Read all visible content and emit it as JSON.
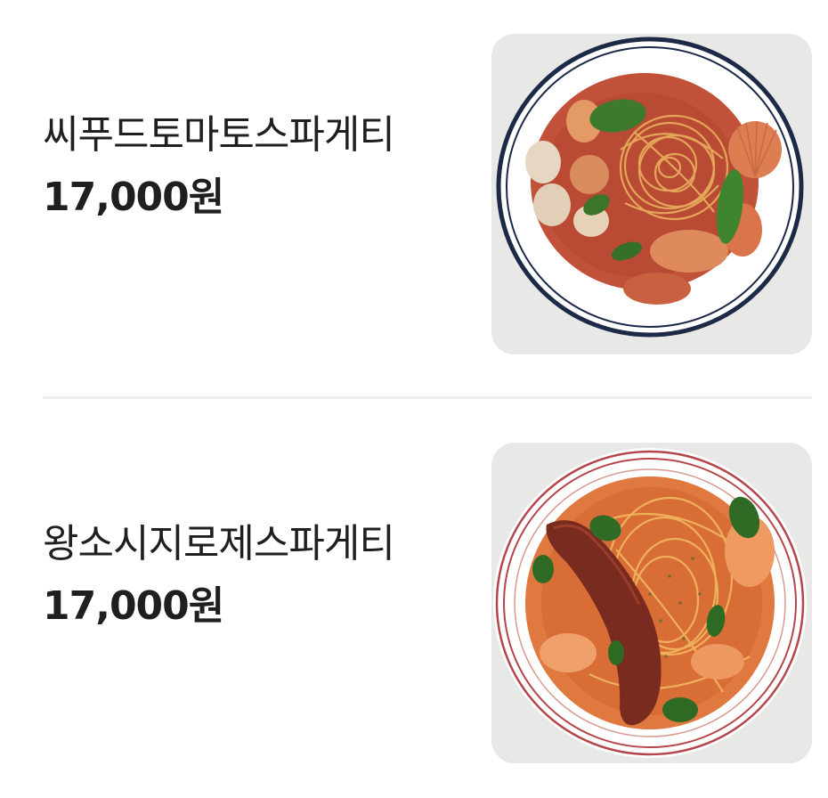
{
  "menu": {
    "items": [
      {
        "name": "씨푸드토마토스파게티",
        "price": "17,000원",
        "photo_icon": "seafood-tomato-pasta-photo",
        "plate_rim_color": "#1c2a48"
      },
      {
        "name": "왕소시지로제스파게티",
        "price": "17,000원",
        "photo_icon": "sausage-rose-pasta-photo",
        "plate_rim_color": "#b5454a"
      }
    ]
  }
}
